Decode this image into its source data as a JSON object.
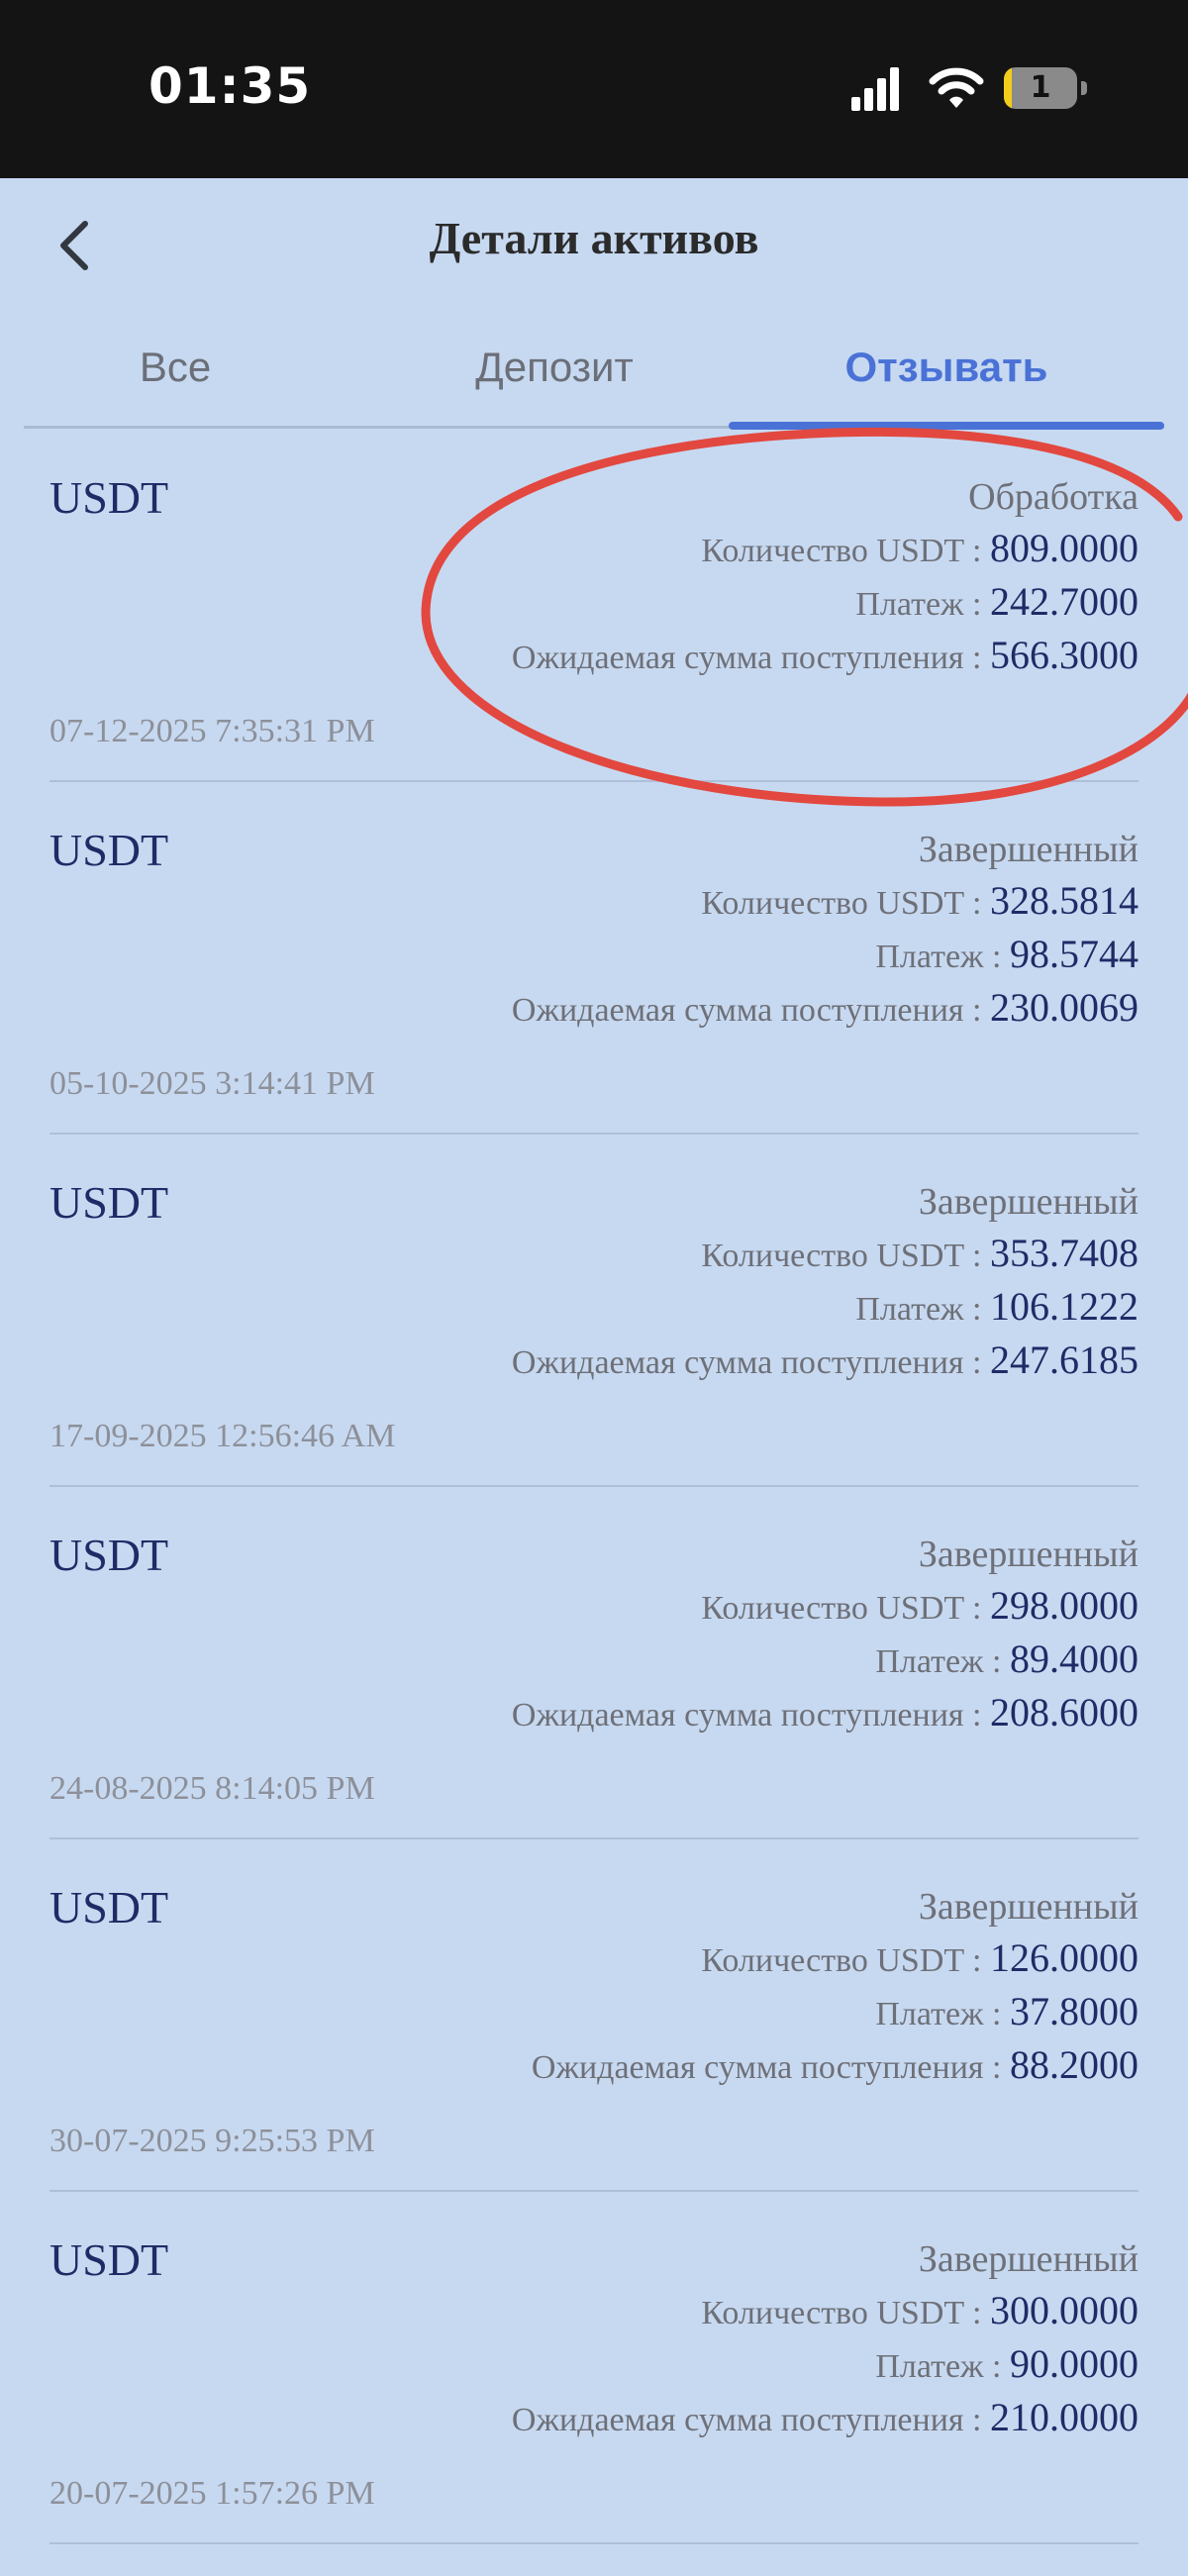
{
  "status_bar": {
    "time": "01:35",
    "battery_level": "1"
  },
  "header": {
    "title": "Детали активов"
  },
  "tabs": [
    {
      "label": "Все",
      "active": false
    },
    {
      "label": "Депозит",
      "active": false
    },
    {
      "label": "Отзывать",
      "active": true
    }
  ],
  "labels": {
    "quantity": "Количество USDT : ",
    "fee": "Платеж : ",
    "expected": "Ожидаемая сумма поступления : "
  },
  "items": [
    {
      "currency": "USDT",
      "status": "Обработка",
      "quantity": "809.0000",
      "fee": "242.7000",
      "expected": "566.3000",
      "date": "07-12-2025 7:35:31 PM"
    },
    {
      "currency": "USDT",
      "status": "Завершенный",
      "quantity": "328.5814",
      "fee": "98.5744",
      "expected": "230.0069",
      "date": "05-10-2025 3:14:41 PM"
    },
    {
      "currency": "USDT",
      "status": "Завершенный",
      "quantity": "353.7408",
      "fee": "106.1222",
      "expected": "247.6185",
      "date": "17-09-2025 12:56:46 AM"
    },
    {
      "currency": "USDT",
      "status": "Завершенный",
      "quantity": "298.0000",
      "fee": "89.4000",
      "expected": "208.6000",
      "date": "24-08-2025 8:14:05 PM"
    },
    {
      "currency": "USDT",
      "status": "Завершенный",
      "quantity": "126.0000",
      "fee": "37.8000",
      "expected": "88.2000",
      "date": "30-07-2025 9:25:53 PM"
    },
    {
      "currency": "USDT",
      "status": "Завершенный",
      "quantity": "300.0000",
      "fee": "90.0000",
      "expected": "210.0000",
      "date": "20-07-2025 1:57:26 PM"
    }
  ],
  "colors": {
    "background": "#c7d9f1",
    "accent": "#4a72d6",
    "annotation": "#e2483f"
  }
}
